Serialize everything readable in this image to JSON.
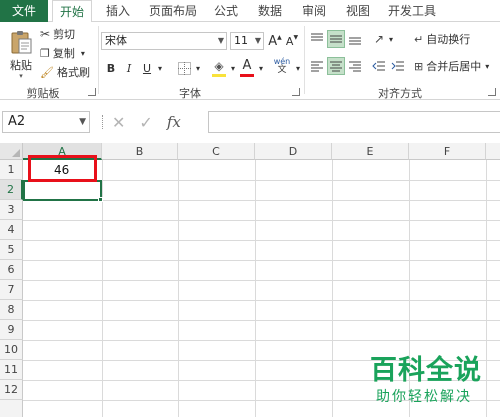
{
  "tabs": [
    "文件",
    "开始",
    "插入",
    "页面布局",
    "公式",
    "数据",
    "审阅",
    "视图",
    "开发工具"
  ],
  "active_tab": "开始",
  "clipboard": {
    "paste_label": "粘贴",
    "cut_label": "剪切",
    "copy_label": "复制",
    "format_painter_label": "格式刷",
    "group_label": "剪贴板"
  },
  "font": {
    "font_name": "宋体",
    "font_size": "11",
    "bold_label": "B",
    "italic_label": "I",
    "underline_label": "U",
    "grow_label": "A",
    "shrink_label": "A",
    "font_color_label": "A",
    "phonetic_label": "wén",
    "group_label": "字体",
    "highlight_color": "#f9e23b",
    "font_color": "#e8101a"
  },
  "alignment": {
    "wrap_text_label": "自动换行",
    "merge_center_label": "合并后居中",
    "group_label": "对齐方式"
  },
  "formula_bar": {
    "name_box": "A2",
    "fx_label": "fx",
    "formula_value": ""
  },
  "columns": [
    "A",
    "B",
    "C",
    "D",
    "E",
    "F"
  ],
  "rows": [
    "1",
    "2",
    "3",
    "4",
    "5",
    "6",
    "7",
    "8",
    "9",
    "10",
    "11",
    "12"
  ],
  "cells": {
    "A1": "46"
  },
  "active_cell": "A2",
  "watermark": {
    "title": "百科全说",
    "subtitle": "助你轻松解决"
  },
  "colors": {
    "accent": "#217346",
    "highlight_box": "#e8101a",
    "watermark": "#1aa35b"
  }
}
